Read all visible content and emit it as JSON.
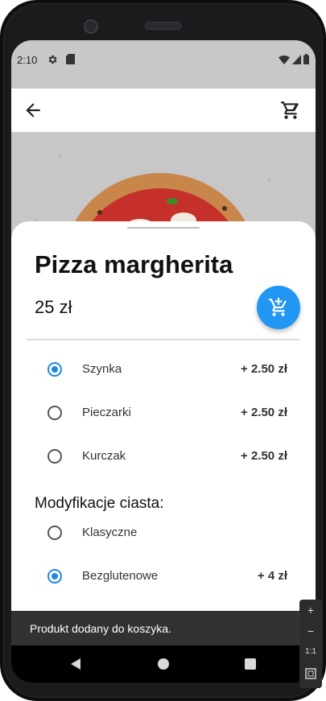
{
  "status_bar": {
    "time": "2:10"
  },
  "product": {
    "title": "Pizza margherita",
    "price": "25 zł"
  },
  "options": [
    {
      "label": "Szynka",
      "price": "+ 2.50 zł",
      "checked": true
    },
    {
      "label": "Pieczarki",
      "price": "+ 2.50 zł",
      "checked": false
    },
    {
      "label": "Kurczak",
      "price": "+ 2.50 zł",
      "checked": false
    }
  ],
  "dough_section": {
    "title": "Modyfikacje ciasta:",
    "options": [
      {
        "label": "Klasyczne",
        "price": "",
        "checked": false
      },
      {
        "label": "Bezglutenowe",
        "price": "+ 4 zł",
        "checked": true
      }
    ]
  },
  "snackbar": {
    "message": "Produkt dodany do koszyka."
  },
  "zoom_controls": {
    "plus": "+",
    "minus": "−",
    "one_to_one": "1:1"
  },
  "colors": {
    "accent": "#2196f3",
    "radio_checked": "#1e88e5",
    "snackbar_bg": "#323232"
  },
  "icons": {
    "back": "arrow-left-icon",
    "cart": "shopping-cart-icon",
    "fab": "add-shopping-cart-icon"
  }
}
